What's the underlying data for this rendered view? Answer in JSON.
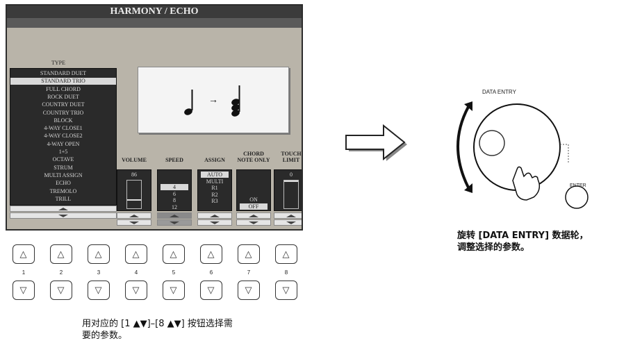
{
  "screen": {
    "title": "HARMONY / ECHO",
    "type_label": "TYPE",
    "type_items": [
      "STANDARD DUET",
      "STANDARD TRIO",
      "FULL CHORD",
      "ROCK DUET",
      "COUNTRY DUET",
      "COUNTRY TRIO",
      "BLOCK",
      "4-WAY CLOSE1",
      "4-WAY CLOSE2",
      "4-WAY OPEN",
      "1+5",
      "OCTAVE",
      "STRUM",
      "MULTI ASSIGN",
      "ECHO",
      "TREMOLO",
      "TRILL"
    ],
    "selected_type_index": 1,
    "preview_arrow": "→",
    "columns": [
      {
        "head": "VOLUME",
        "values": [
          "86"
        ],
        "selected": -1,
        "level": 0.67
      },
      {
        "head": "SPEED",
        "values": [
          "4",
          "6",
          "8",
          "12"
        ],
        "selected": 0
      },
      {
        "head": "ASSIGN",
        "values": [
          "AUTO",
          "MULTI",
          "R1",
          "R2",
          "R3"
        ],
        "selected": 0
      },
      {
        "head": "CHORD NOTE ONLY",
        "values": [
          "ON",
          "OFF"
        ],
        "selected": 1
      },
      {
        "head": "TOUCH LIMIT",
        "values": [
          "0"
        ],
        "selected": -1,
        "level": 0.0
      }
    ]
  },
  "buttons": {
    "up_glyph": "△",
    "down_glyph": "▽",
    "numbers": [
      "1",
      "2",
      "3",
      "4",
      "5",
      "6",
      "7",
      "8"
    ]
  },
  "captions": {
    "buttons_line1": "用对应的 [1 ▲▼]–[8 ▲▼] 按钮选择需",
    "buttons_line2": "要的参数。",
    "dial_line1": "旋转 [DATA ENTRY] 数据轮，",
    "dial_line2": "调整选择的参数。"
  },
  "dial": {
    "label": "DATA ENTRY",
    "enter_label": "ENTER"
  }
}
